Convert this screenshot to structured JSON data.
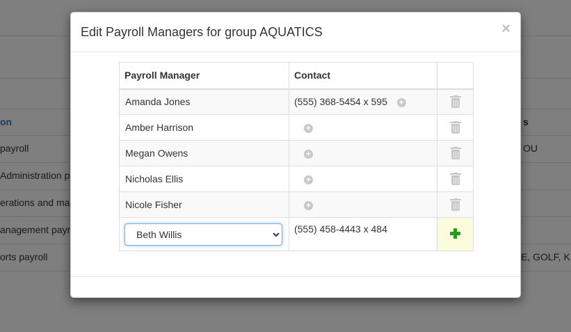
{
  "background": {
    "column_headers": [
      "on",
      "s"
    ],
    "rows": [
      {
        "label": "payroll",
        "extra": "OU"
      },
      {
        "label": "Administration pa",
        "extra": ""
      },
      {
        "label": "erations and ma",
        "extra": ""
      },
      {
        "label": "anagement payro",
        "extra": ""
      },
      {
        "label": "orts payroll",
        "extra": "E, GOLF, K"
      }
    ]
  },
  "modal": {
    "title": "Edit Payroll Managers for group AQUATICS",
    "close_glyph": "×"
  },
  "table": {
    "headers": {
      "manager": "Payroll Manager",
      "contact": "Contact"
    },
    "rows": [
      {
        "name": "Amanda Jones",
        "contact": "(555) 368-5454 x 595"
      },
      {
        "name": "Amber Harrison",
        "contact": ""
      },
      {
        "name": "Megan Owens",
        "contact": ""
      },
      {
        "name": "Nicholas Ellis",
        "contact": ""
      },
      {
        "name": "Nicole Fisher",
        "contact": ""
      }
    ],
    "new_row": {
      "selected_manager": "Beth Willis",
      "contact": "(555) 458-4443 x 484"
    }
  },
  "icons": {
    "add_contact": "plus-circle-icon",
    "delete": "trash-icon",
    "add_row": "plus-icon"
  },
  "colors": {
    "link_blue": "#337ab7",
    "add_green": "#2a9a1c",
    "add_cell_bg": "#fcfcdc"
  }
}
